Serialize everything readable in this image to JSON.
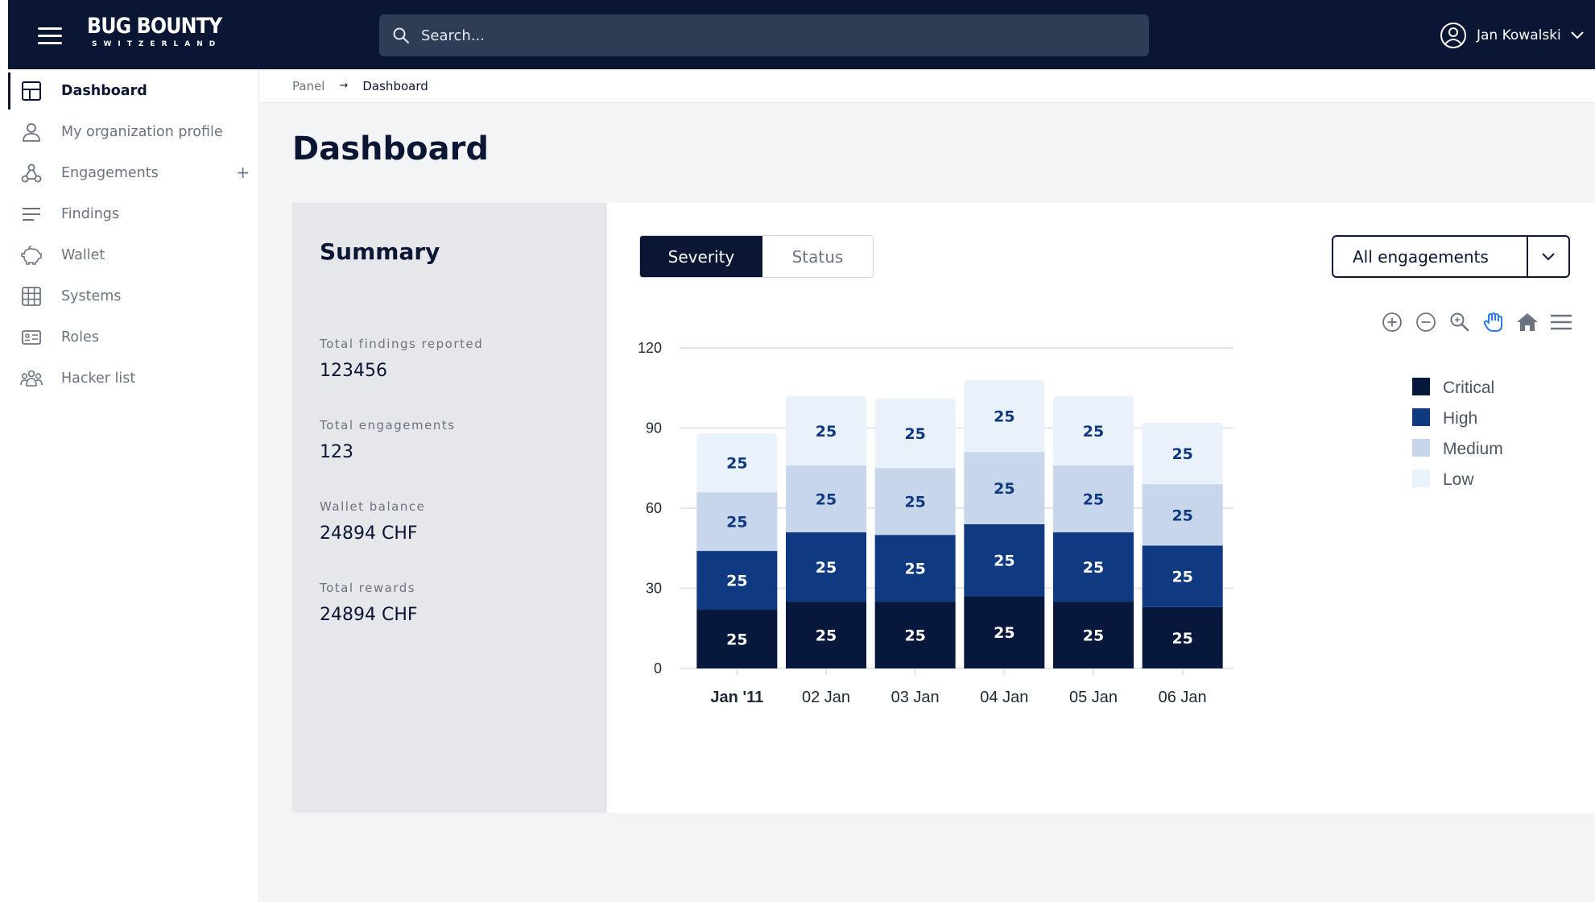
{
  "header": {
    "logo_main": "BUG BOUNTY",
    "logo_sub": "SWITZERLAND",
    "search_placeholder": "Search...",
    "user_name": "Jan Kowalski"
  },
  "sidebar": {
    "items": [
      {
        "label": "Dashboard",
        "icon": "layout-icon",
        "active": true
      },
      {
        "label": "My organization profile",
        "icon": "user-icon"
      },
      {
        "label": "Engagements",
        "icon": "hierarchy-icon",
        "action": "+"
      },
      {
        "label": "Findings",
        "icon": "list-icon"
      },
      {
        "label": "Wallet",
        "icon": "piggy-bank-icon"
      },
      {
        "label": "Systems",
        "icon": "grid-icon"
      },
      {
        "label": "Roles",
        "icon": "id-card-icon"
      },
      {
        "label": "Hacker list",
        "icon": "users-group-icon"
      }
    ]
  },
  "breadcrumb": {
    "root": "Panel",
    "separator": "→",
    "current": "Dashboard"
  },
  "page_title": "Dashboard",
  "summary": {
    "title": "Summary",
    "stats": [
      {
        "label": "Total findings reported",
        "value": "123456"
      },
      {
        "label": "Total engagements",
        "value": "123"
      },
      {
        "label": "Wallet balance",
        "value": "24894 CHF"
      },
      {
        "label": "Total rewards",
        "value": "24894 CHF"
      }
    ]
  },
  "chart_controls": {
    "tabs": [
      {
        "label": "Severity",
        "active": true
      },
      {
        "label": "Status",
        "active": false
      }
    ],
    "filter": "All engagements",
    "toolbar_icons": [
      "zoom-in-icon",
      "zoom-out-icon",
      "magnifier-icon",
      "pan-hand-icon",
      "home-icon",
      "menu-icon"
    ]
  },
  "colors": {
    "navy": "#0a1633",
    "critical": "#08183d",
    "high": "#0f3a82",
    "medium": "#c7d6ea",
    "low": "#e9f1fb",
    "accent_blue": "#2c7be5"
  },
  "chart_data": {
    "type": "bar",
    "stacked": true,
    "categories": [
      "Jan '11",
      "02 Jan",
      "03 Jan",
      "04 Jan",
      "05 Jan",
      "06 Jan"
    ],
    "series": [
      {
        "name": "Critical",
        "values": [
          22,
          25,
          25,
          27,
          25,
          23
        ],
        "labels": [
          "25",
          "25",
          "25",
          "25",
          "25",
          "25"
        ],
        "color": "#08183d"
      },
      {
        "name": "High",
        "values": [
          22,
          26,
          25,
          27,
          26,
          23
        ],
        "labels": [
          "25",
          "25",
          "25",
          "25",
          "25",
          "25"
        ],
        "color": "#0f3a82"
      },
      {
        "name": "Medium",
        "values": [
          22,
          25,
          25,
          27,
          25,
          23
        ],
        "labels": [
          "25",
          "25",
          "25",
          "25",
          "25",
          "25"
        ],
        "color": "#c7d6ea"
      },
      {
        "name": "Low",
        "values": [
          22,
          26,
          26,
          27,
          26,
          23
        ],
        "labels": [
          "25",
          "25",
          "25",
          "25",
          "25",
          "25"
        ],
        "color": "#e9f1fb"
      }
    ],
    "y_ticks": [
      0,
      30,
      60,
      90,
      120
    ],
    "ylim": [
      0,
      120
    ],
    "grid": true,
    "legend": "right"
  }
}
